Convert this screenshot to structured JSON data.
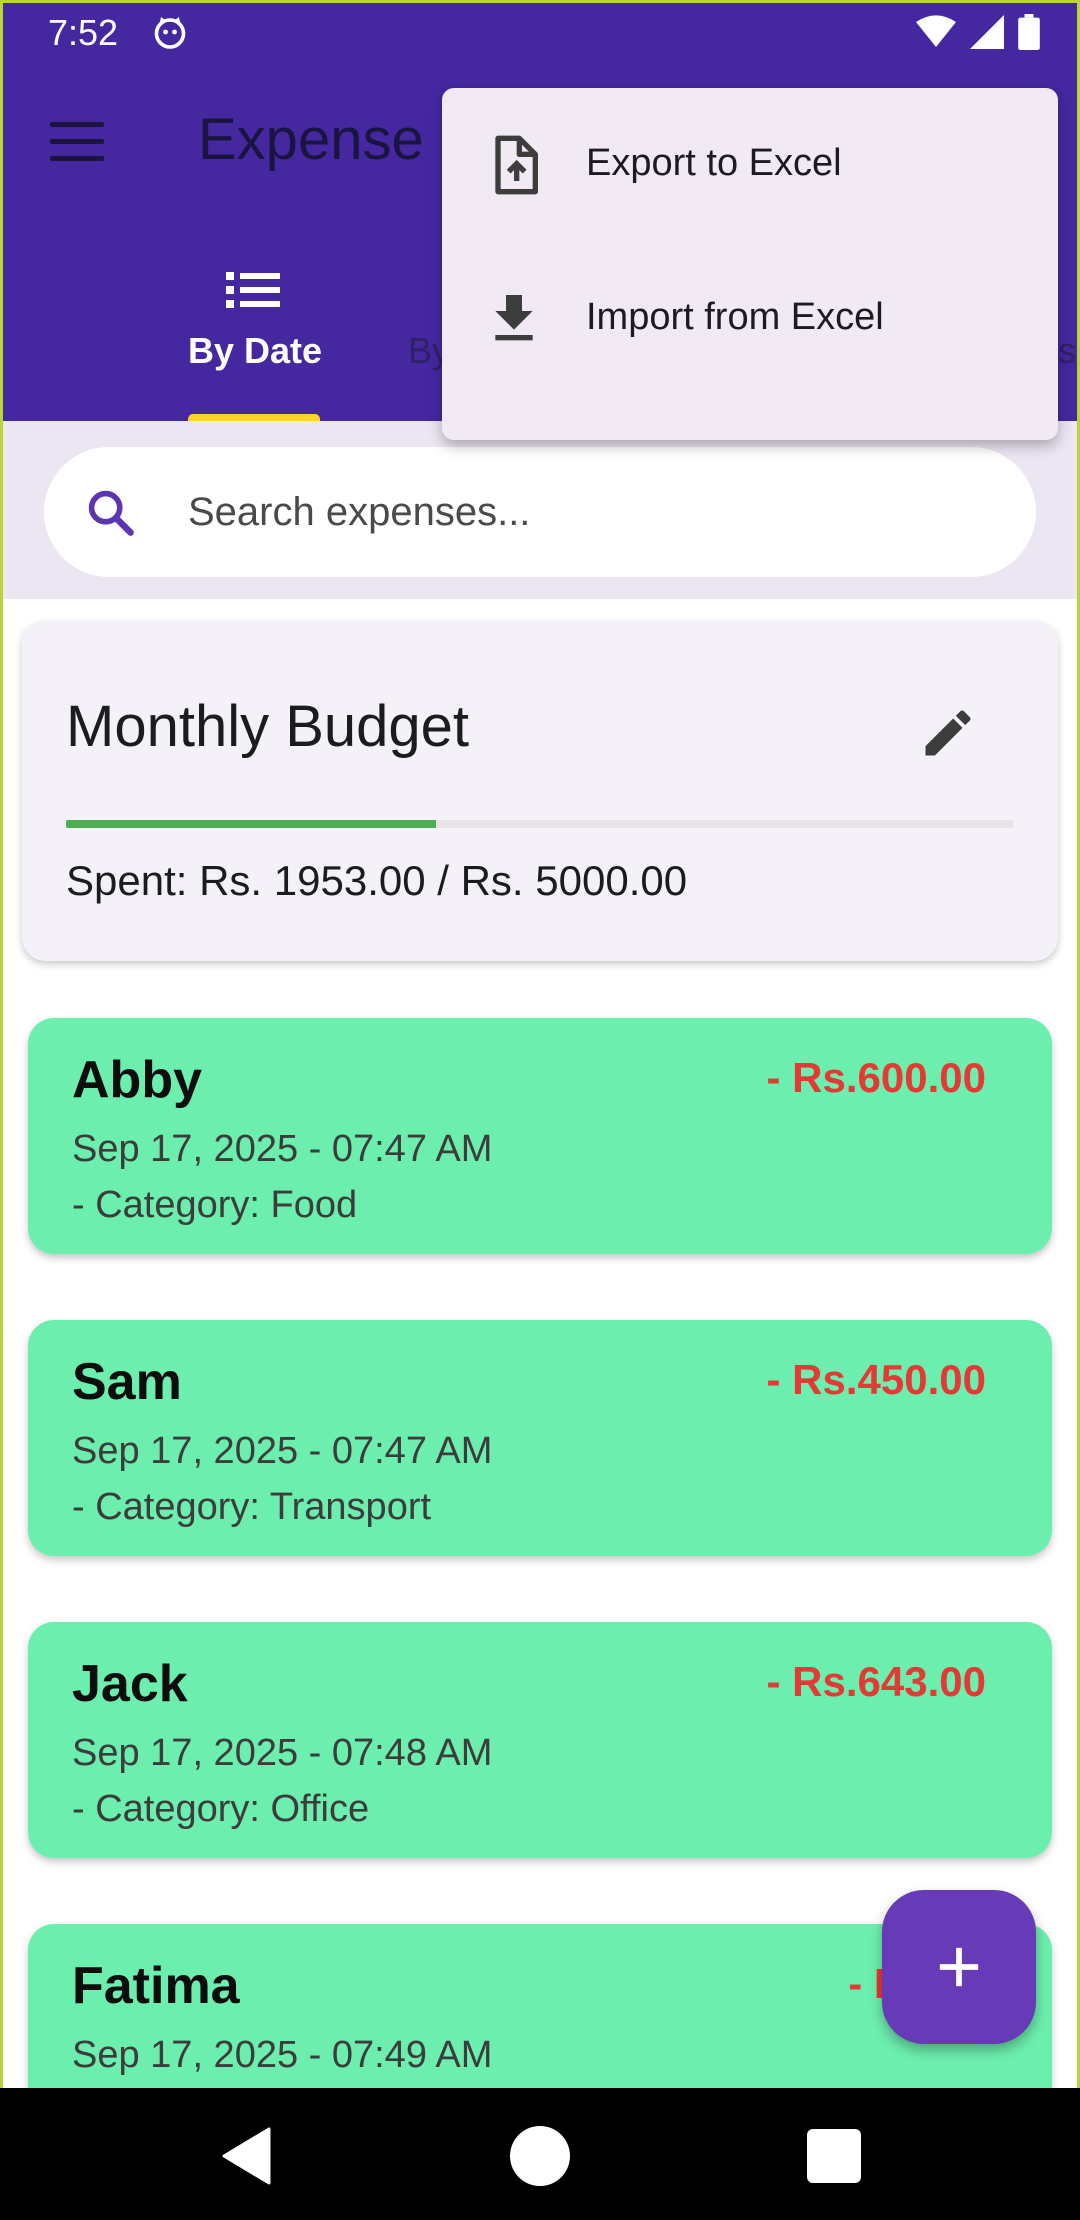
{
  "status_bar": {
    "time": "7:52"
  },
  "app_bar": {
    "title": "Expense",
    "tabs": [
      {
        "label": "By Date",
        "selected": true
      },
      {
        "label": "By",
        "selected": false
      }
    ]
  },
  "menu": {
    "items": [
      {
        "label": "Export to Excel",
        "icon": "file-upload-icon"
      },
      {
        "label": "Import from Excel",
        "icon": "download-icon"
      }
    ]
  },
  "search": {
    "placeholder": "Search expenses..."
  },
  "budget": {
    "title": "Monthly Budget",
    "spent_text": "Spent: Rs. 1953.00 / Rs. 5000.00",
    "progress_fraction": 0.39,
    "progress_color": "#4caf50"
  },
  "expenses": [
    {
      "name": "Abby",
      "amount": "- Rs.600.00",
      "date": "Sep 17, 2025 - 07:47 AM",
      "category": "- Category: Food"
    },
    {
      "name": "Sam",
      "amount": "- Rs.450.00",
      "date": "Sep 17, 2025 - 07:47 AM",
      "category": "- Category: Transport"
    },
    {
      "name": "Jack",
      "amount": "- Rs.643.00",
      "date": "Sep 17, 2025 - 07:48 AM",
      "category": "- Category: Office"
    },
    {
      "name": "Fatima",
      "amount": "- Rs.26",
      "date": "Sep 17, 2025 - 07:49 AM",
      "category": ""
    }
  ],
  "colors": {
    "app_bar": "#4527a0",
    "tab_indicator": "#ffd428",
    "expense_card": "#6ceeae",
    "amount_text": "#e53935",
    "fab": "#673ab7"
  }
}
